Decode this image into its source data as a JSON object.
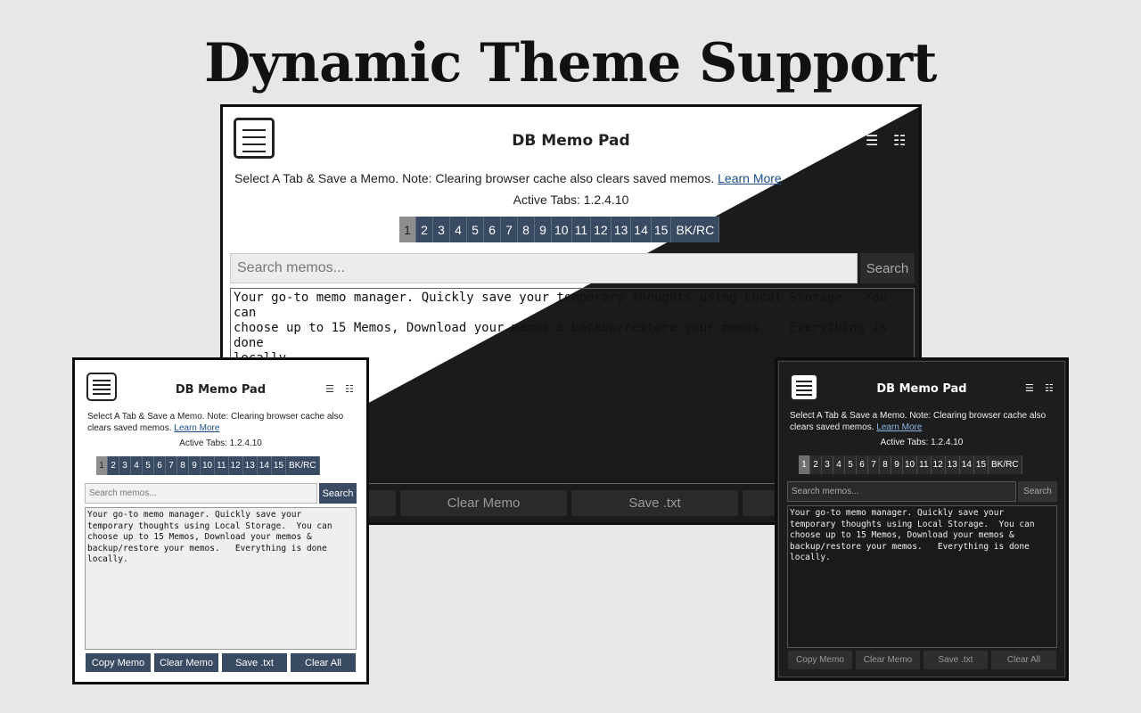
{
  "headline": "Dynamic Theme Support",
  "app": {
    "title": "DB Memo Pad",
    "menu_icon": "☰",
    "grid_icon": "☷",
    "note_text": "Select A Tab & Save a Memo. Note: Clearing browser cache also clears saved memos. ",
    "learn_more": "Learn More",
    "active_tabs": "Active Tabs: 1.2.4.10",
    "tabs": [
      "1",
      "2",
      "3",
      "4",
      "5",
      "6",
      "7",
      "8",
      "9",
      "10",
      "11",
      "12",
      "13",
      "14",
      "15",
      "BK/RC"
    ],
    "selected_tab": "1",
    "search_placeholder": "Search memos...",
    "search_button": "Search",
    "memo_text": "Your go-to memo manager. Quickly save your temporary thoughts using Local Storage.  You can choose up to 15 Memos, Download your memos & backup/restore your memos.   Everything is done locally.",
    "memo_text_narrow": "Your go-to memo manager. Quickly save your\ntemporary thoughts using Local Storage.  You can\nchoose up to 15 Memos, Download your memos &\nbackup/restore your memos.   Everything is done\nlocally.",
    "memo_text_wide": "Your go-to memo manager. Quickly save your temporary thoughts using Local Storage.  You can\nchoose up to 15 Memos, Download your memos & backup/restore your memos.   Everything is done\nlocally.",
    "buttons": {
      "copy": "Copy Memo",
      "clear": "Clear Memo",
      "save": "Save .txt",
      "clear_all": "Clear All"
    }
  },
  "colors": {
    "background": "#e7e7e7",
    "tab_bg": "#394a63",
    "tab_selected": "#8e8e8e",
    "dark_bg": "#1d1d1d",
    "link": "#1a4f8c"
  },
  "icons": [
    "memo-logo-icon",
    "menu-icon",
    "grid-icon"
  ]
}
